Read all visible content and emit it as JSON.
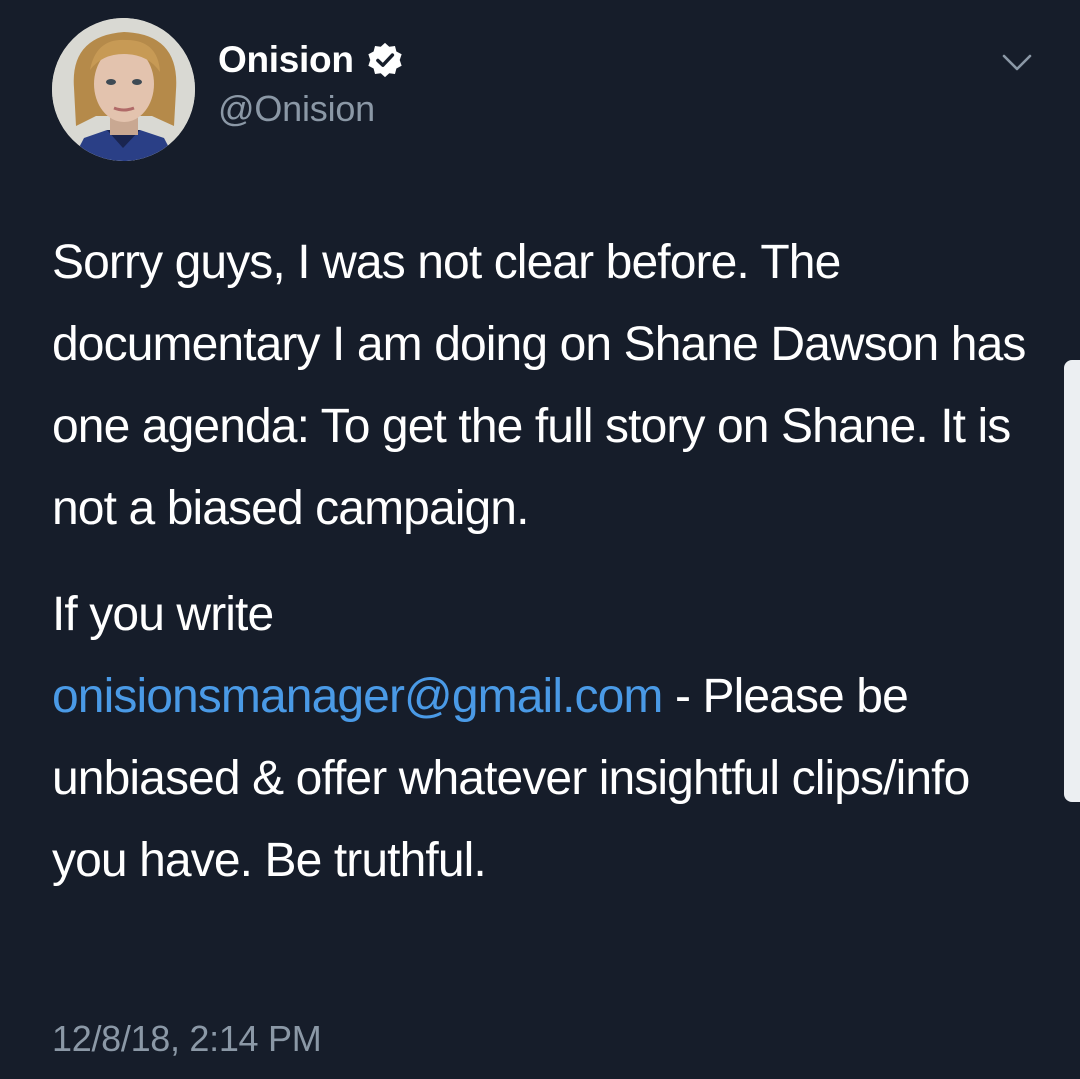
{
  "author": {
    "display_name": "Onision",
    "handle": "@Onision",
    "verified": true,
    "avatar_icon": "profile-photo"
  },
  "tweet": {
    "paragraph_1": "Sorry guys, I was not clear before. The documentary I am doing on Shane Dawson has one agenda: To get the full story on Shane. It is not a biased campaign.",
    "paragraph_2_intro": "If you write ",
    "paragraph_2_email": "onisionsmanager@gmail.com",
    "paragraph_2_rest": " - Please be unbiased & offer whatever insightful clips/info you have. Be truthful.",
    "timestamp": "12/8/18, 2:14 PM"
  },
  "icons": {
    "verified": "verified-badge-icon",
    "menu": "chevron-down-icon"
  },
  "colors": {
    "background": "#161d2a",
    "text": "#ffffff",
    "secondary_text": "#8b98a6",
    "link": "#4a9ae6"
  }
}
